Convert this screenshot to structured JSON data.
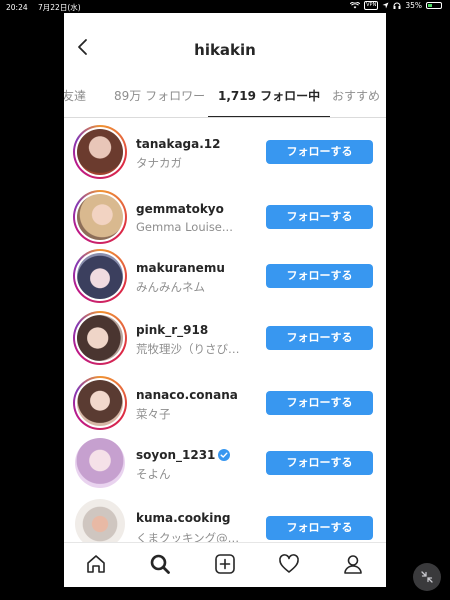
{
  "status_bar": {
    "time": "20:24",
    "date": "7月22日(水)",
    "battery_percent": "35%",
    "vpn": "VPN",
    "battery_level": 0.35
  },
  "header": {
    "title": "hikakin"
  },
  "tabs": [
    {
      "label": "の友達"
    },
    {
      "label": "89万 フォロワー"
    },
    {
      "label": "1,719 フォロー中",
      "active": true
    },
    {
      "label": "おすすめ"
    }
  ],
  "users": [
    {
      "username": "tanakaga.12",
      "name": "タナカガ",
      "button": "フォローする",
      "story_ring": true
    },
    {
      "username": "gemmatokyo",
      "name": "Gemma Louise...",
      "button": "フォローする",
      "story_ring": true
    },
    {
      "username": "makuranemu",
      "name": "みんみんネム",
      "button": "フォローする",
      "story_ring": true
    },
    {
      "username": "pink_r_918",
      "name": "荒牧理沙（りさび…",
      "button": "フォローする",
      "story_ring": true
    },
    {
      "username": "nanaco.conana",
      "name": "菜々子",
      "button": "フォローする",
      "story_ring": true
    },
    {
      "username": "soyon_1231",
      "name": "そよん",
      "button": "フォローする",
      "story_ring": false,
      "verified": true
    },
    {
      "username": "kuma.cooking",
      "name": "くまクッキング@…",
      "button": "フォローする",
      "story_ring": false
    }
  ],
  "bottom_nav": [
    "home-icon",
    "search-icon",
    "add-post-icon",
    "heart-icon",
    "profile-icon"
  ],
  "colors": {
    "accent": "#3897f0",
    "active_tab": "#262626"
  }
}
